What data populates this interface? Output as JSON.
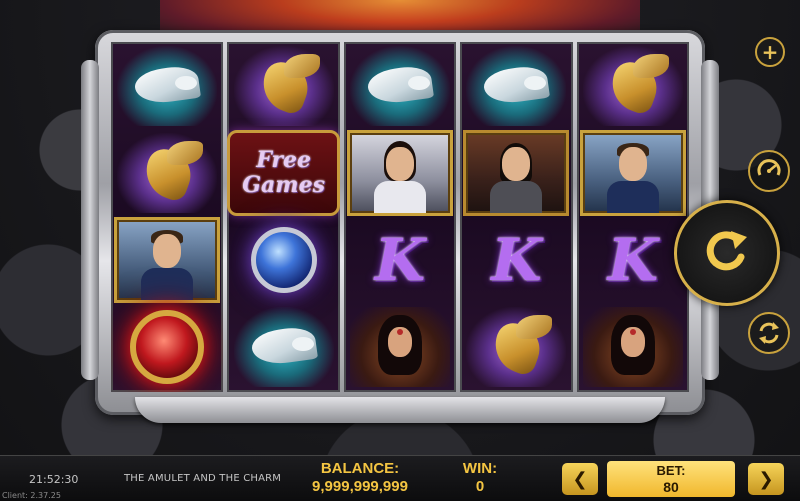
{
  "game_title": "THE AMULET AND THE CHARM",
  "clock": "21:52:30",
  "client_version": "Client: 2.37.25",
  "balance": {
    "label": "BALANCE:",
    "value": "9,999,999,999"
  },
  "win": {
    "label": "WIN:",
    "value": "0"
  },
  "bet": {
    "label": "BET:",
    "value": "80"
  },
  "controls": {
    "bet_decrease": "❮",
    "bet_increase": "❯",
    "plus": "+",
    "spin_icon": "spin-arrow-icon",
    "auto_icon": "autoplay-gauge-icon",
    "turbo_icon": "quick-spin-icon"
  },
  "reels": [
    [
      "white-dove",
      "gold-dragon",
      "knight-portrait",
      "red-amulet"
    ],
    [
      "gold-dragon",
      "free-games",
      "blue-charm",
      "white-dove"
    ],
    [
      "white-dove",
      "princess-portrait",
      "K",
      "dark-sorceress"
    ],
    [
      "white-dove",
      "warrior-portrait",
      "K",
      "gold-dragon"
    ],
    [
      "gold-dragon",
      "knight-portrait",
      "K",
      "dark-sorceress"
    ]
  ],
  "free_games_text": {
    "line1": "Free",
    "line2": "Games"
  },
  "colors": {
    "gold": "#f4c542",
    "frame_silver": "#c9c9ce",
    "k_purple": "#b46df0",
    "bar_bg": "#141416"
  }
}
